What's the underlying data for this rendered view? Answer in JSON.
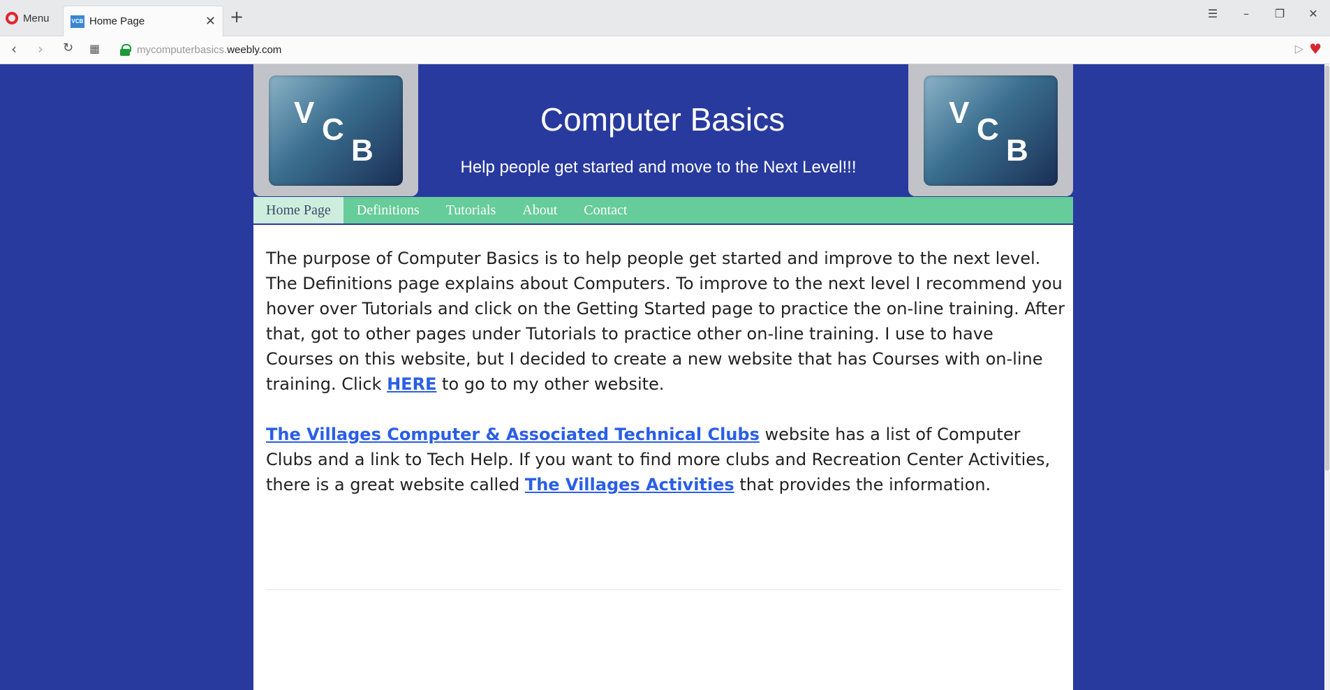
{
  "browser": {
    "menu_label": "Menu",
    "tab_title": "Home Page",
    "favicon_text": "VCB",
    "url_prefix": "mycomputerbasics.",
    "url_domain": "weebly.com"
  },
  "site": {
    "logo": {
      "v": "V",
      "c": "C",
      "b": "B"
    },
    "title": "Computer Basics",
    "tagline": "Help people get started and move to the Next Level!!!"
  },
  "nav": {
    "items": [
      {
        "label": "Home Page"
      },
      {
        "label": "Definitions"
      },
      {
        "label": "Tutorials"
      },
      {
        "label": "About"
      },
      {
        "label": "Contact"
      }
    ]
  },
  "content": {
    "p1_text": "The purpose of Computer Basics is to help people get started and improve to the next level.  The Definitions page explains about Computers.  To improve to the next level I recommend you hover over Tutorials and click on the Getting Started page to practice the on-line training.  After that, got to other pages under Tutorials to practice other on-line training.  I use to have Courses on this website, but I decided to create a new website that has Courses with on-line training.  Click ",
    "p1_link": "HERE",
    "p1_end": " to go to my other website.",
    "p2_link1": "The Villages Computer & Associated Technical Clubs",
    "p2_mid": " website has a list of Computer Clubs and a link to Tech Help.  If you want to find more clubs and Recreation Center Activities, there is a great website called ",
    "p2_link2": "The Villages Activities",
    "p2_end": " that provides the information."
  },
  "colors": {
    "page_bg": "#283a9e",
    "nav_bg": "#66cc99",
    "link": "#2a5ee8"
  }
}
